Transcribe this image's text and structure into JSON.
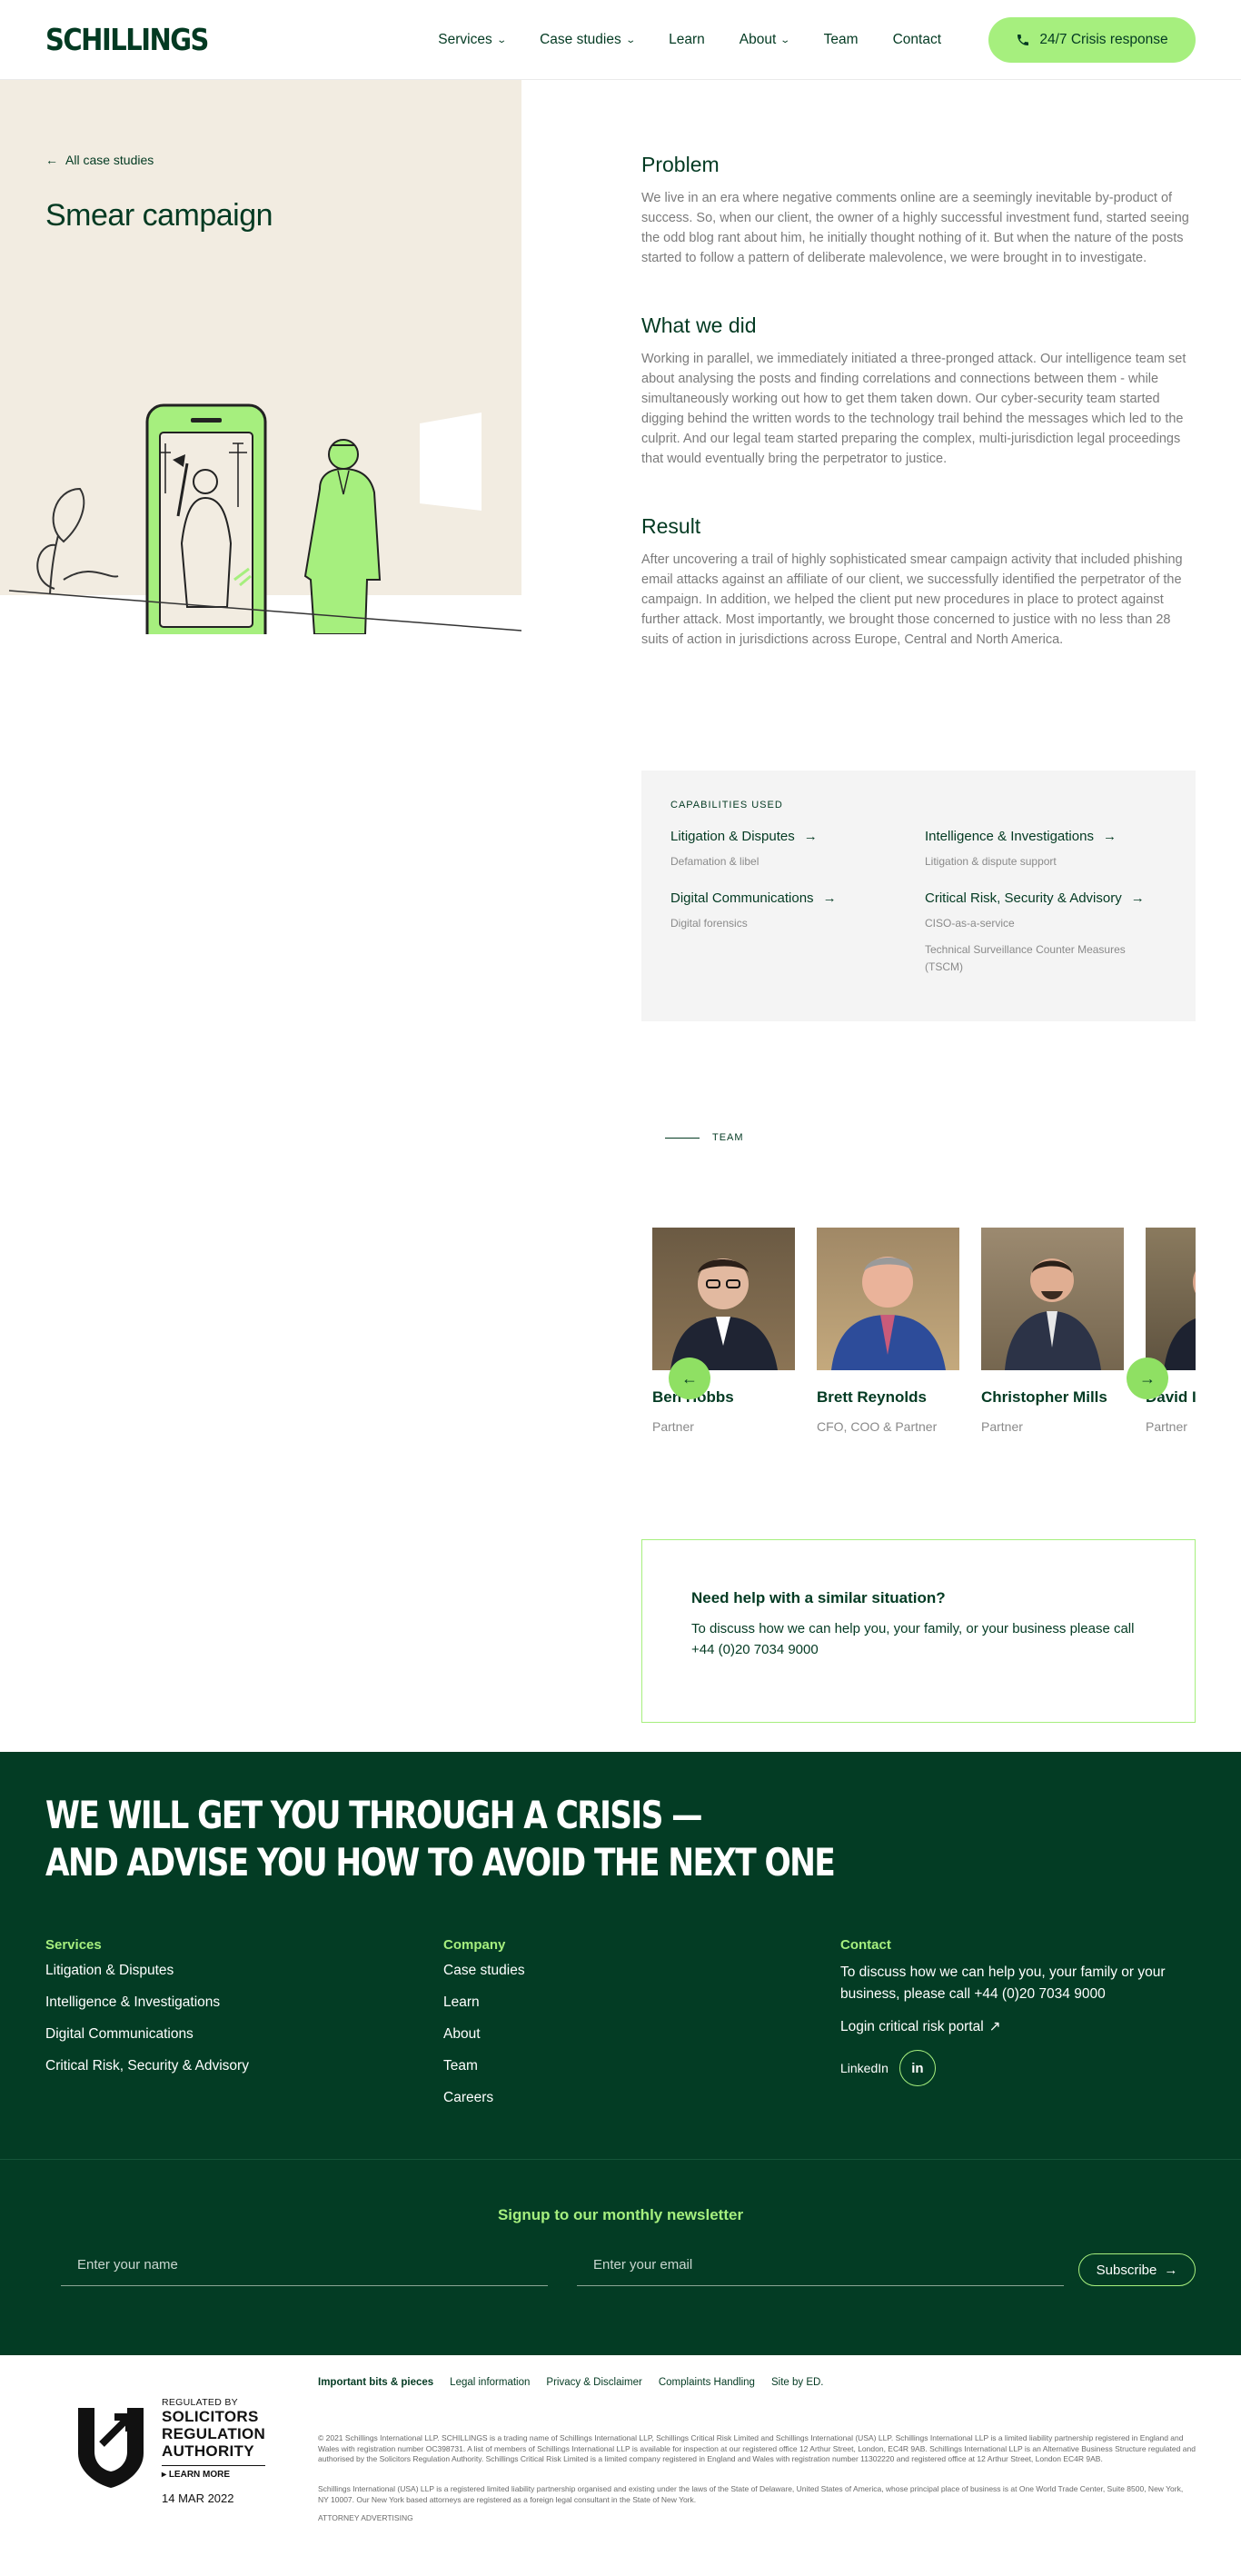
{
  "header": {
    "logo": "SCHILLINGS",
    "nav": [
      "Services",
      "Case studies",
      "Learn",
      "About",
      "Team",
      "Contact"
    ],
    "crisis_button": "24/7 Crisis response"
  },
  "hero": {
    "back_link": "All case studies",
    "title": "Smear campaign"
  },
  "article": {
    "problem_title": "Problem",
    "problem_text": "We live in an era where negative comments online are a seemingly inevitable by-product of success. So, when our client, the owner of a highly successful investment fund, started seeing the odd blog rant about him, he initially thought nothing of it. But when the nature of the posts started to follow a pattern of deliberate malevolence, we were brought in to investigate.",
    "what_title": "What we did",
    "what_text": "Working in parallel, we immediately initiated a three-pronged attack. Our intelligence team set about analysing the posts and finding correlations and connections between them - while simultaneously working out how to get them taken down. Our cyber-security team started digging behind the written words to the technology trail behind the messages which led to the culprit. And our legal team started preparing the complex, multi-jurisdiction legal proceedings that would eventually bring the perpetrator to justice.",
    "result_title": "Result",
    "result_text": "After uncovering a trail of highly sophisticated smear campaign activity that included phishing email attacks against an affiliate of our client, we successfully identified the perpetrator of the campaign. In addition, we helped the client put new procedures in place to protect against further attack. Most importantly, we brought those concerned to justice with no less than 28 suits of action in jurisdictions across Europe, Central and North America."
  },
  "capabilities": {
    "label": "CAPABILITIES USED",
    "items": [
      {
        "title": "Litigation & Disputes",
        "subs": [
          "Defamation & libel"
        ]
      },
      {
        "title": "Intelligence & Investigations",
        "subs": [
          "Litigation & dispute support"
        ]
      },
      {
        "title": "Digital Communications",
        "subs": [
          "Digital forensics"
        ]
      },
      {
        "title": "Critical Risk, Security & Advisory",
        "subs": [
          "CISO-as-a-service",
          "Technical Surveillance Counter Measures (TSCM)"
        ]
      }
    ]
  },
  "team": {
    "label": "TEAM",
    "members": [
      {
        "name": "Ben Hobbs",
        "role": "Partner"
      },
      {
        "name": "Brett Reynolds",
        "role": "CFO, COO & Partner"
      },
      {
        "name": "Christopher Mills",
        "role": "Partner"
      },
      {
        "name": "David Imison",
        "role": "Partner"
      }
    ]
  },
  "help": {
    "title": "Need help with a similar situation?",
    "text": "To discuss how we can help you, your family, or your business please call +44 (0)20 7034 9000"
  },
  "footer": {
    "headline_1": "WE WILL GET YOU THROUGH A CRISIS —",
    "headline_2": "AND ADVISE YOU HOW TO AVOID THE NEXT ONE",
    "services_title": "Services",
    "services": [
      "Litigation & Disputes",
      "Intelligence & Investigations",
      "Digital Communications",
      "Critical Risk, Security & Advisory"
    ],
    "company_title": "Company",
    "company": [
      "Case studies",
      "Learn",
      "About",
      "Team",
      "Careers"
    ],
    "contact_title": "Contact",
    "contact_text": "To discuss how we can help you, your family or your business, please call +44 (0)20 7034 9000",
    "portal_link": "Login critical risk portal",
    "linkedin_label": "LinkedIn",
    "linkedin_icon_text": "in",
    "newsletter_title": "Signup to our monthly newsletter",
    "name_placeholder": "Enter your name",
    "email_placeholder": "Enter your email",
    "subscribe": "Subscribe"
  },
  "legal": {
    "sra_regulated": "REGULATED BY",
    "sra_name_1": "SOLICITORS",
    "sra_name_2": "REGULATION",
    "sra_name_3": "AUTHORITY",
    "sra_learn": "LEARN MORE",
    "sra_date": "14 MAR 2022",
    "links": [
      "Important bits & pieces",
      "Legal information",
      "Privacy & Disclaimer",
      "Complaints Handling",
      "Site by ED."
    ],
    "para1": "© 2021 Schillings International LLP. SCHILLINGS is a trading name of Schillings International LLP, Schillings Critical Risk Limited and Schillings International (USA) LLP. Schillings International LLP is a limited liability partnership registered in England and Wales with registration number OC398731. A list of members of Schillings International LLP is available for inspection at our registered office 12 Arthur Street, London, EC4R 9AB. Schillings International LLP is an Alternative Business Structure regulated and authorised by the Solicitors Regulation Authority. Schillings Critical Risk Limited is a limited company registered in England and Wales with registration number 11302220 and registered office at 12 Arthur Street, London EC4R 9AB.",
    "para2": "Schillings International (USA) LLP is a registered limited liability partnership organised and existing under the laws of the State of Delaware, United States of America, whose principal place of business is at One World Trade Center, Suite 8500, New York, NY 10007. Our New York based attorneys are registered as a foreign legal consultant in the State of New York.",
    "para3": "ATTORNEY ADVERTISING"
  },
  "colors": {
    "brand_green": "#033a22",
    "accent_lime": "#a6ef7e",
    "footer_bg": "#033c24",
    "hero_bg": "#f2ece1"
  },
  "icons": {
    "phone": "phone-icon",
    "back": "arrow-left-icon",
    "cap_arrow": "arrow-right-icon",
    "prev": "arrow-left-icon",
    "next": "arrow-right-icon",
    "external": "external-link-icon",
    "linkedin": "linkedin-icon",
    "sra_logo": "sra-shield-icon"
  }
}
